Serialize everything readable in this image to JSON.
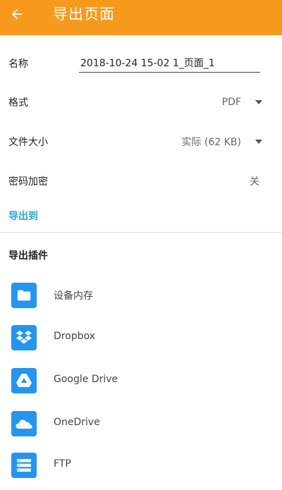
{
  "appbar": {
    "title": "导出页面",
    "back_icon": "arrow-left-icon",
    "color": "#F79A1B"
  },
  "form": {
    "name_label": "名称",
    "name_value": "2018-10-24 15-02 1_页面_1",
    "format_label": "格式",
    "format_value": "PDF",
    "size_label": "文件大小",
    "size_value": "实际 (62 KB)",
    "password_label": "密码加密",
    "password_value": "关"
  },
  "export_to_link": "导出到",
  "plugins": {
    "title": "导出插件",
    "accent": "#2196F3",
    "items": [
      {
        "label": "设备内存",
        "icon": "folder-icon"
      },
      {
        "label": "Dropbox",
        "icon": "dropbox-icon"
      },
      {
        "label": "Google Drive",
        "icon": "google-drive-icon"
      },
      {
        "label": "OneDrive",
        "icon": "onedrive-icon"
      },
      {
        "label": "FTP",
        "icon": "ftp-icon"
      }
    ]
  }
}
